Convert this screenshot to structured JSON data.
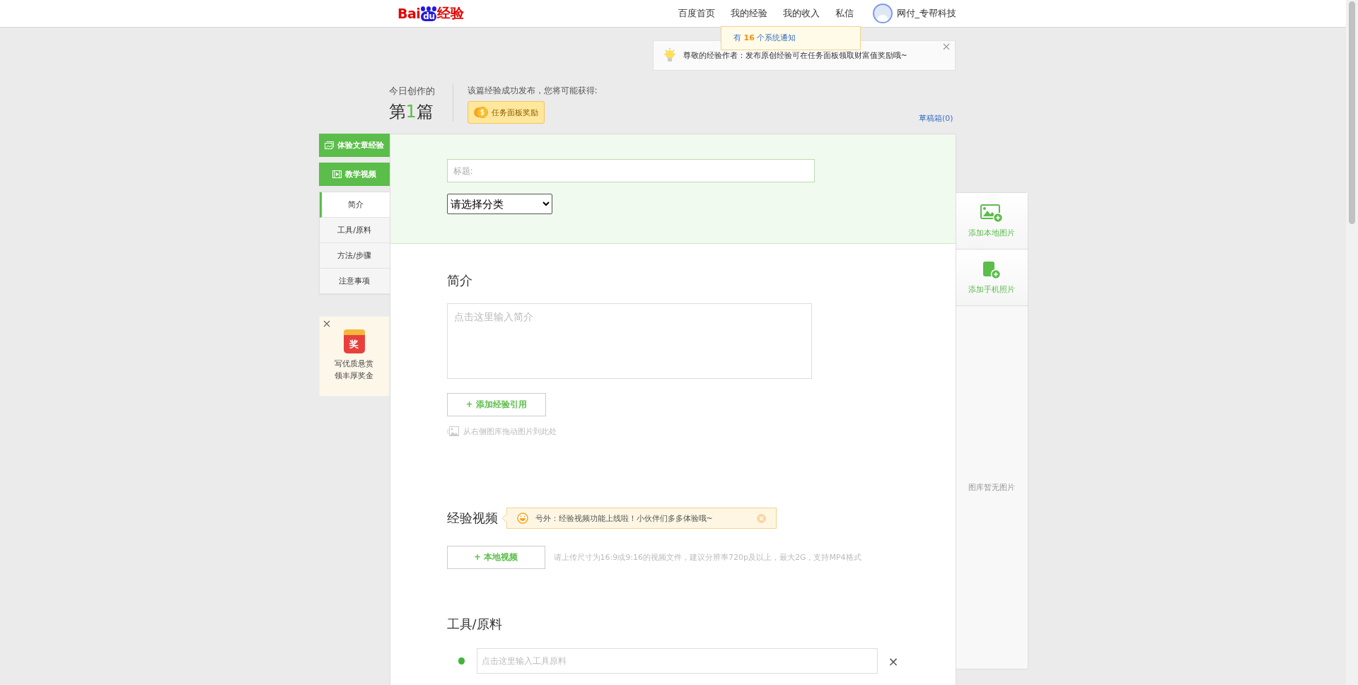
{
  "logo": {
    "left": "Bai",
    "paw": "du",
    "right": "经验"
  },
  "nav": [
    {
      "label": "百度首页"
    },
    {
      "label": "我的经验"
    },
    {
      "label": "我的收入"
    },
    {
      "label": "私信"
    }
  ],
  "user": {
    "name": "网付_专帮科技"
  },
  "notification": {
    "prefix": "有",
    "count": "16",
    "suffix": "个系统通知"
  },
  "tip": {
    "text": "尊敬的经验作者：发布原创经验可在任务面板领取财富值奖励哦~"
  },
  "stats": {
    "label": "今日创作的",
    "prefix": "第",
    "count": "1",
    "suffix": "篇"
  },
  "reward": {
    "text": "该篇经验成功发布，您将可能获得:",
    "button": "任务面板奖励"
  },
  "drafts": "草稿箱(0)",
  "sidebar": {
    "buttons": [
      {
        "label": "体验文章经验",
        "kind": "article"
      },
      {
        "label": "教学视频",
        "kind": "video"
      }
    ],
    "items": [
      {
        "label": "简介",
        "selected": true
      },
      {
        "label": "工具/原料",
        "selected": false
      },
      {
        "label": "方法/步骤",
        "selected": false
      },
      {
        "label": "注意事项",
        "selected": false
      }
    ],
    "promo": {
      "badge": "奖",
      "lines": [
        "写优质悬赏",
        "领丰厚奖金"
      ]
    }
  },
  "form": {
    "title_placeholder": "标题:",
    "category": "请选择分类"
  },
  "intro": {
    "heading": "简介",
    "placeholder": "点击这里输入简介",
    "button": "+ 添加经验引用",
    "drag_hint": "从右侧图库拖动图片到此处"
  },
  "video": {
    "heading": "经验视频",
    "notice": "号外：经验视频功能上线啦！小伙伴们多多体验哦~",
    "button": "+ 本地视频",
    "hint": "请上传尺寸为16:9或9:16的视频文件，建议分辨率720p及以上，最大2G，支持MP4格式"
  },
  "tools": {
    "heading": "工具/原料",
    "placeholder": "点击这里输入工具原料",
    "remove": "×"
  },
  "gallery": {
    "items": [
      {
        "label": "添加本地图片",
        "kind": "image"
      },
      {
        "label": "添加手机照片",
        "kind": "phone"
      }
    ],
    "empty": "图库暂无图片"
  }
}
